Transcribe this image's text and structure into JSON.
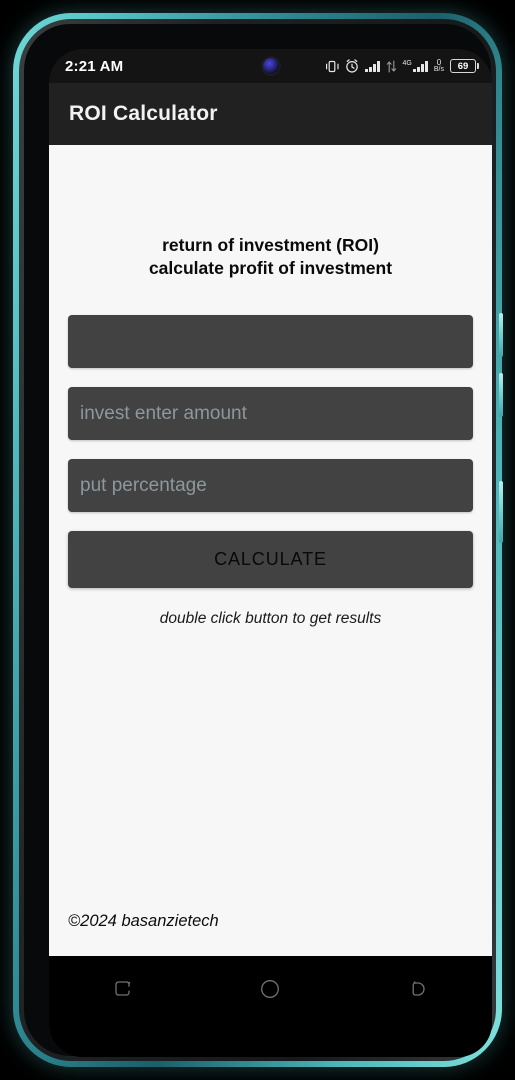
{
  "device": {
    "frame_color": "#5fd6d6",
    "side_buttons": [
      "volume-up",
      "volume-down",
      "power"
    ],
    "camera": "front-camera"
  },
  "status_bar": {
    "time": "2:21 AM",
    "icons": [
      {
        "name": "vibrate-icon",
        "label": "vibrate"
      },
      {
        "name": "alarm-icon",
        "label": "alarm"
      },
      {
        "name": "signal-bars-icon",
        "label": "signal"
      },
      {
        "name": "data-transfer-icon",
        "label": "data-transfer"
      },
      {
        "name": "network-type-icon",
        "label": "4G"
      }
    ],
    "network_type": "4G",
    "data_rate_value": "0",
    "data_rate_unit": "B/s",
    "battery_level": "69"
  },
  "app_bar": {
    "title": "ROI Calculator"
  },
  "main": {
    "heading_line1": "return of investment (ROI)",
    "heading_line2": "calculate profit of investment",
    "result_field": {
      "value": "",
      "placeholder": ""
    },
    "amount_field": {
      "value": "",
      "placeholder": "invest enter amount"
    },
    "percentage_field": {
      "value": "",
      "placeholder": "put percentage"
    },
    "calculate_label": "CALCULATE",
    "hint": "double click button to get results",
    "footer": "©2024 basanzietech"
  },
  "nav_bar": {
    "recents_label": "recents",
    "home_label": "home",
    "back_label": "back"
  },
  "colors": {
    "app_bar_bg": "#212121",
    "content_bg": "#f7f7f7",
    "field_bg": "#424242",
    "placeholder": "#8d979c",
    "frame": "#5fd6d6"
  }
}
